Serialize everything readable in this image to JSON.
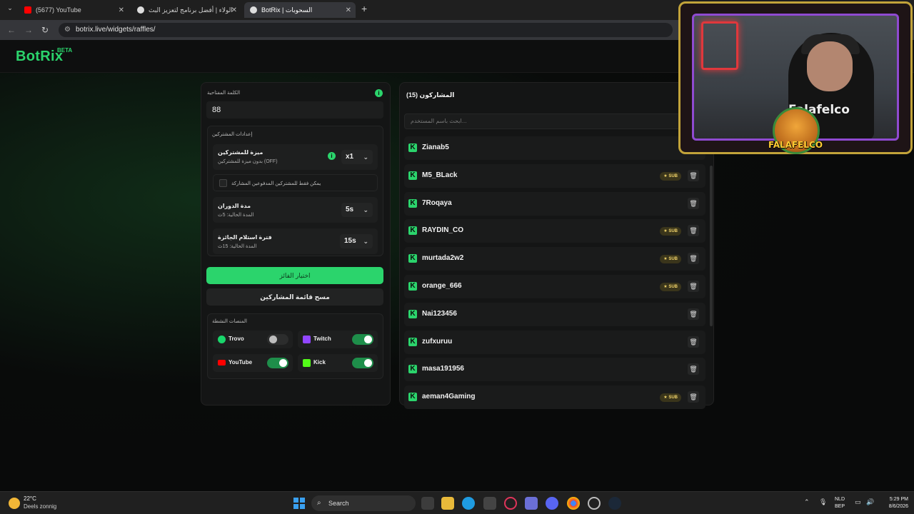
{
  "browser": {
    "tabs": [
      {
        "title": "(5677) YouTube",
        "active": false
      },
      {
        "title": "الولاء | أفضل برنامج لتعزيز البث",
        "active": false
      },
      {
        "title": "BotRix | السحوبات",
        "active": true
      }
    ],
    "url": "botrix.live/widgets/raffles/",
    "new_tab": "+"
  },
  "site": {
    "logo": "BotRix",
    "beta": "BETA"
  },
  "left_panel": {
    "keyword_label": "الكلمة المفتاحية",
    "keyword_value": "88",
    "participants_settings_title": "إعدادات المشتركين",
    "subscriber_bonus": {
      "title": "ميزة للمشتركين",
      "sub": "بدون ميزة للمشتركين (OFF)",
      "value": "x1"
    },
    "paid_only_label": "يمكن فقط للمشتركين المدفوعين المشاركة",
    "spin_duration": {
      "title": "مدة الدوران",
      "sub": "المدة الحالية: 5ث",
      "value": "5s"
    },
    "claim_period": {
      "title": "فترة استلام الجائزة",
      "sub": "المدة الحالية: 15ث",
      "value": "15s"
    },
    "pick_winner_button": "اختيار الفائز",
    "clear_list_button": "مسح قائمة المشاركين",
    "active_platforms_title": "المنصات النشطة",
    "platforms": [
      {
        "name": "Trovo",
        "enabled": false,
        "color": "#19d66b"
      },
      {
        "name": "Twitch",
        "enabled": true,
        "color": "#9146ff"
      },
      {
        "name": "YouTube",
        "enabled": true,
        "color": "#ff0000"
      },
      {
        "name": "Kick",
        "enabled": true,
        "color": "#53fc18"
      }
    ]
  },
  "right_panel": {
    "title": "المشاركون (15)",
    "search_placeholder": "ابحث باسم المستخدم...",
    "sub_badge": "SUB",
    "participants": [
      {
        "name": "Zianab5",
        "sub": false
      },
      {
        "name": "M5_BLack",
        "sub": true
      },
      {
        "name": "7Roqaya",
        "sub": false
      },
      {
        "name": "RAYDIN_CO",
        "sub": true
      },
      {
        "name": "murtada2w2",
        "sub": true
      },
      {
        "name": "orange_666",
        "sub": true
      },
      {
        "name": "Nai123456",
        "sub": false
      },
      {
        "name": "zufxuruu",
        "sub": false
      },
      {
        "name": "masa191956",
        "sub": false
      },
      {
        "name": "aeman4Gaming",
        "sub": true
      }
    ]
  },
  "overlay": {
    "shirt_text": "Falafelco",
    "badge": "FALAFELCO"
  },
  "taskbar": {
    "temperature": "22°C",
    "condition": "Deels zonnig",
    "search": "Search",
    "lang_top": "NLD",
    "lang_bottom": "BEP",
    "time": "5:29 PM",
    "date": "8/6/2026"
  }
}
